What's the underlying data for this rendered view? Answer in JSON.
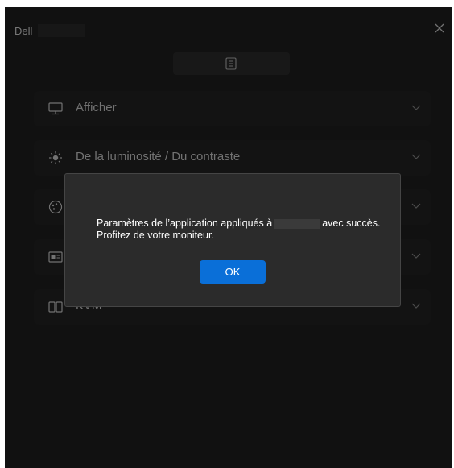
{
  "window": {
    "brand": "Dell",
    "close_icon": "close-icon",
    "top_tab_icon": "document-icon"
  },
  "menu": {
    "items": [
      {
        "label": "Afficher",
        "icon": "monitor-icon"
      },
      {
        "label": "De la luminosité / Du contraste",
        "icon": "brightness-icon"
      },
      {
        "label": "",
        "icon": "palette-icon"
      },
      {
        "label": "",
        "icon": "picture-icon"
      },
      {
        "label": "KVM",
        "icon": "kvm-icon"
      }
    ]
  },
  "dialog": {
    "message_part1": "Paramètres de l’application appliqués à",
    "message_part2": "avec succès.",
    "message_line2": "Profitez de votre moniteur.",
    "ok_label": "OK"
  },
  "colors": {
    "window_bg": "#1f1f1f",
    "row_bg": "#232323",
    "dialog_bg": "#2b2b2b",
    "accent": "#0a6fd8"
  }
}
